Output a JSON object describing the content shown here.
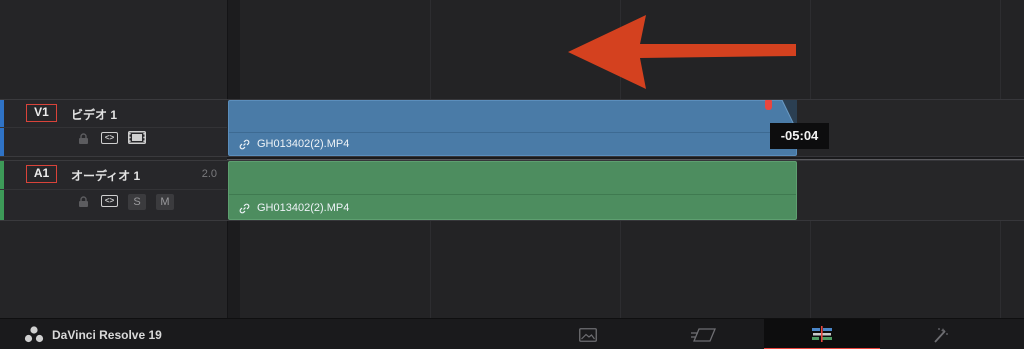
{
  "tracks": {
    "video": {
      "badge": "V1",
      "name": "ビデオ 1",
      "clip_name": "GH013402(2).MP4"
    },
    "audio": {
      "badge": "A1",
      "name": "オーディオ 1",
      "channels": "2.0",
      "clip_name": "GH013402(2).MP4",
      "solo_label": "S",
      "mute_label": "M"
    }
  },
  "timecode_tooltip": "-05:04",
  "brand": {
    "name": "DaVinci Resolve 19"
  },
  "page_tabs": [
    {
      "name": "media-page",
      "icon": "image-icon",
      "active": false
    },
    {
      "name": "cut-page",
      "icon": "cut-icon",
      "active": false
    },
    {
      "name": "edit-page",
      "icon": "edit-timeline-icon",
      "active": true
    },
    {
      "name": "fusion-page",
      "icon": "magic-wand-icon",
      "active": false
    }
  ],
  "colors": {
    "video_track": "#4a7ba7",
    "audio_track": "#4d8d5f",
    "accent": "#e8463f",
    "annotation_arrow": "#d4411f"
  }
}
